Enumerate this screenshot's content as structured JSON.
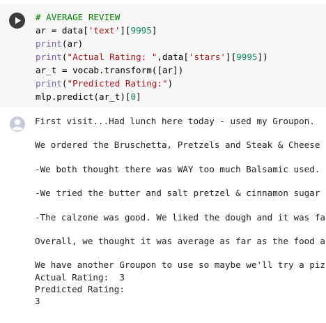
{
  "code_cell": {
    "run_button_label": "",
    "lines": {
      "l1": "# AVERAGE REVIEW",
      "l2_a": "ar = data[",
      "l2_s": "'text'",
      "l2_b": "][",
      "l2_n": "9995",
      "l2_c": "]",
      "l3_f": "print",
      "l3_a": "(ar)",
      "l4_f": "print",
      "l4_a": "(",
      "l4_s1": "\"Actual Rating: \"",
      "l4_b": ",data[",
      "l4_s2": "'stars'",
      "l4_c": "][",
      "l4_n": "9995",
      "l4_d": "])",
      "l5": "ar_t = vocab.transform([ar])",
      "l6_f": "print",
      "l6_a": "(",
      "l6_s": "\"Predicted Rating:\"",
      "l6_b": ")",
      "l7_a": "mlp.predict(ar_t)[",
      "l7_n": "0",
      "l7_b": "]"
    }
  },
  "output": {
    "o1": "First visit...Had lunch here today - used my Groupon.",
    "o2": "",
    "o3": "We ordered the Bruschetta, Pretzels and Steak & Cheese",
    "o4": "",
    "o5": "-We both thought there was WAY too much Balsamic used.",
    "o6": "",
    "o7": "-We tried the butter and salt pretzel & cinnamon sugar",
    "o8": "",
    "o9": "-The calzone was good. We liked the dough and it was fa",
    "o10": "",
    "o11": "Overall, we thought it was average as far as the food a",
    "o12": "",
    "o13": "We have another Groupon to use so maybe we'll try a piz",
    "o14": "Actual Rating:  3",
    "o15": "Predicted Rating:",
    "o16": "3"
  },
  "colors": {
    "cell_background": "#f7f7f7",
    "comment": "#008000",
    "builtin": "#795da3",
    "string": "#a31515",
    "number": "#098658"
  },
  "icons": {
    "run": "play-circle-icon",
    "output": "user-avatar-icon"
  }
}
